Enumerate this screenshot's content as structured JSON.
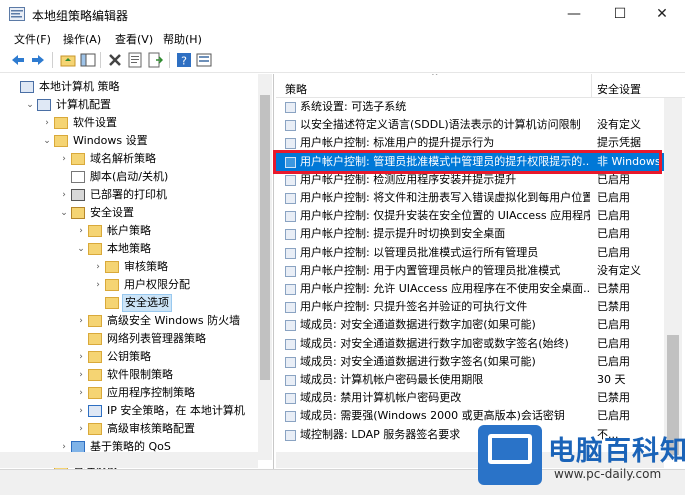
{
  "window": {
    "title": "本地组策略编辑器",
    "minimize": "—",
    "maximize": "☐",
    "close": "✕"
  },
  "menu": [
    "文件(F)",
    "操作(A)",
    "查看(V)",
    "帮助(H)"
  ],
  "toolbar": {
    "icons": [
      "back-icon",
      "forward-icon",
      "up-icon",
      "show-hide-tree-icon",
      "delete-icon",
      "properties-icon",
      "export-icon",
      "help-icon",
      "view-icon"
    ]
  },
  "tree": [
    {
      "label": "本地计算机 策略",
      "indent": 0,
      "expander": "",
      "icon": "computer"
    },
    {
      "label": "计算机配置",
      "indent": 1,
      "expander": "⌄",
      "icon": "computer"
    },
    {
      "label": "软件设置",
      "indent": 2,
      "expander": "›",
      "icon": "folder"
    },
    {
      "label": "Windows 设置",
      "indent": 2,
      "expander": "⌄",
      "icon": "folder"
    },
    {
      "label": "域名解析策略",
      "indent": 3,
      "expander": "›",
      "icon": "folder"
    },
    {
      "label": "脚本(启动/关机)",
      "indent": 3,
      "expander": "",
      "icon": "script"
    },
    {
      "label": "已部署的打印机",
      "indent": 3,
      "expander": "›",
      "icon": "printer"
    },
    {
      "label": "安全设置",
      "indent": 3,
      "expander": "⌄",
      "icon": "security"
    },
    {
      "label": "帐户策略",
      "indent": 4,
      "expander": "›",
      "icon": "folder"
    },
    {
      "label": "本地策略",
      "indent": 4,
      "expander": "⌄",
      "icon": "folder"
    },
    {
      "label": "审核策略",
      "indent": 5,
      "expander": "›",
      "icon": "folder"
    },
    {
      "label": "用户权限分配",
      "indent": 5,
      "expander": "›",
      "icon": "folder"
    },
    {
      "label": "安全选项",
      "indent": 5,
      "expander": "",
      "icon": "folder",
      "selected": true
    },
    {
      "label": "高级安全 Windows 防火墙",
      "indent": 4,
      "expander": "›",
      "icon": "folder"
    },
    {
      "label": "网络列表管理器策略",
      "indent": 4,
      "expander": "",
      "icon": "folder"
    },
    {
      "label": "公钥策略",
      "indent": 4,
      "expander": "›",
      "icon": "folder"
    },
    {
      "label": "软件限制策略",
      "indent": 4,
      "expander": "›",
      "icon": "folder"
    },
    {
      "label": "应用程序控制策略",
      "indent": 4,
      "expander": "›",
      "icon": "folder"
    },
    {
      "label": "IP 安全策略，在 本地计算机",
      "indent": 4,
      "expander": "›",
      "icon": "ipsec"
    },
    {
      "label": "高级审核策略配置",
      "indent": 4,
      "expander": "›",
      "icon": "folder"
    },
    {
      "label": "基于策略的 QoS",
      "indent": 3,
      "expander": "›",
      "icon": "qos"
    },
    {
      "label": "管理模板",
      "indent": 2,
      "expander": "›",
      "icon": "folder"
    }
  ],
  "list": {
    "columns": [
      "策略",
      "安全设置"
    ],
    "sort_arrow": "^",
    "rows": [
      {
        "name": "系统设置: 可选子系统",
        "value": ""
      },
      {
        "name": "以安全描述符定义语言(SDDL)语法表示的计算机访问限制",
        "value": "没有定义"
      },
      {
        "name": "用户帐户控制: 标准用户的提升提示行为",
        "value": "提示凭据"
      },
      {
        "name": "用户帐户控制: 管理员批准模式中管理员的提升权限提示的...",
        "value": "非 Windows",
        "selected": true
      },
      {
        "name": "用户帐户控制: 检测应用程序安装并提示提升",
        "value": "已启用"
      },
      {
        "name": "用户帐户控制: 将文件和注册表写入错误虚拟化到每用户位置",
        "value": "已启用"
      },
      {
        "name": "用户帐户控制: 仅提升安装在安全位置的 UIAccess 应用程序",
        "value": "已启用"
      },
      {
        "name": "用户帐户控制: 提示提升时切换到安全桌面",
        "value": "已启用"
      },
      {
        "name": "用户帐户控制: 以管理员批准模式运行所有管理员",
        "value": "已启用"
      },
      {
        "name": "用户帐户控制: 用于内置管理员帐户的管理员批准模式",
        "value": "没有定义"
      },
      {
        "name": "用户帐户控制: 允许 UIAccess 应用程序在不使用安全桌面...",
        "value": "已禁用"
      },
      {
        "name": "用户帐户控制: 只提升签名并验证的可执行文件",
        "value": "已禁用"
      },
      {
        "name": "域成员: 对安全通道数据进行数字加密(如果可能)",
        "value": "已启用"
      },
      {
        "name": "域成员: 对安全通道数据进行数字加密或数字签名(始终)",
        "value": "已启用"
      },
      {
        "name": "域成员: 对安全通道数据进行数字签名(如果可能)",
        "value": "已启用"
      },
      {
        "name": "域成员: 计算机帐户密码最长使用期限",
        "value": "30 天"
      },
      {
        "name": "域成员: 禁用计算机帐户密码更改",
        "value": "已禁用"
      },
      {
        "name": "域成员: 需要强(Windows 2000 或更高版本)会话密钥",
        "value": "已启用"
      },
      {
        "name": "域控制器: LDAP 服务器签名要求",
        "value": "不..."
      }
    ]
  },
  "watermark": {
    "title": "电脑百科知识",
    "url": "www.pc-daily.com"
  },
  "colors": {
    "selection": "#0078d7",
    "highlight_box": "#e8192c",
    "tree_selection": "#cce4f7",
    "brand": "#1a63b8"
  }
}
